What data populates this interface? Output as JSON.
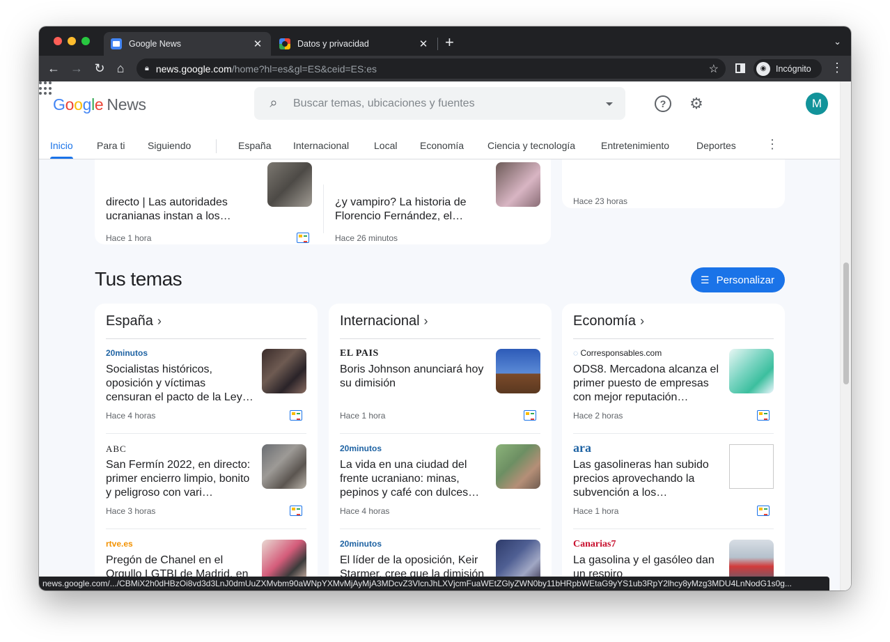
{
  "browser": {
    "tabs": [
      {
        "title": "Google News"
      },
      {
        "title": "Datos y privacidad"
      }
    ],
    "url_host": "news.google.com",
    "url_path": "/home?hl=es&gl=ES&ceid=ES:es",
    "incognito_label": "Incógnito",
    "status_url": "news.google.com/.../CBMiX2h0dHBzOi8vd3d3LnJ0dmUuZXMvbm90aWNpYXMvMjAyMjA3MDcvZ3VlcnJhLXVjcmFuaWEtZGlyZWN0by11bHRpbWEtaG9yYS1ub3RpY2lhcy8yMzg3MDU4LnNodG1s0g..."
  },
  "header": {
    "logo_google": "Google",
    "logo_news": "News",
    "search_placeholder": "Buscar temas, ubicaciones y fuentes",
    "avatar_letter": "M"
  },
  "nav": {
    "tabs": [
      "Inicio",
      "Para ti",
      "Siguiendo",
      "España",
      "Internacional",
      "Local",
      "Economía",
      "Ciencia y tecnología",
      "Entretenimiento",
      "Deportes"
    ]
  },
  "top_stories": [
    {
      "title": "directo | Las autoridades ucranianas instan a los…",
      "time": "Hace 1 hora"
    },
    {
      "title": "¿y vampiro? La historia de Florencio Fernández, el…",
      "time": "Hace 26 minutos"
    },
    {
      "time": "Hace 23 horas"
    }
  ],
  "topics": {
    "section_title": "Tus temas",
    "personalize_label": "Personalizar",
    "cards": [
      {
        "heading": "España",
        "items": [
          {
            "source": "20minutos",
            "title": "Socialistas históricos, oposición y víctimas censuran el pacto de la Ley…",
            "time": "Hace 4 horas"
          },
          {
            "source": "ABC",
            "title": "San Fermín 2022, en directo: primer encierro limpio, bonito y peligroso con vari…",
            "time": "Hace 3 horas"
          },
          {
            "source": "rtve.es",
            "title": "Pregón de Chanel en el Orgullo LGTBI de Madrid, en directo aquí",
            "time": ""
          }
        ]
      },
      {
        "heading": "Internacional",
        "items": [
          {
            "source": "EL PAIS",
            "title": "Boris Johnson anunciará hoy su dimisión",
            "time": "Hace 1 hora"
          },
          {
            "source": "20minutos",
            "title": "La vida en una ciudad del frente ucraniano: minas, pepinos y café con dulces…",
            "time": "Hace 4 horas"
          },
          {
            "source": "20minutos",
            "title": "El líder de la oposición, Keir Starmer, cree que la dimisión de Johnson es una \"buena…",
            "time": ""
          }
        ]
      },
      {
        "heading": "Economía",
        "items": [
          {
            "source": "Corresponsables.com",
            "title": "ODS8. Mercadona alcanza el primer puesto de empresas con mejor reputación…",
            "time": "Hace 2 horas"
          },
          {
            "source": "ara",
            "title": "Las gasolineras han subido precios aprovechando la subvención a los…",
            "time": "Hace 1 hora"
          },
          {
            "source": "Canarias7",
            "title": "La gasolina y el gasóleo dan un respiro",
            "time": ""
          }
        ]
      }
    ]
  },
  "colors": {
    "accent": "#1a73e8",
    "avatar": "#12939a",
    "page_bg": "#f6f8fc"
  }
}
